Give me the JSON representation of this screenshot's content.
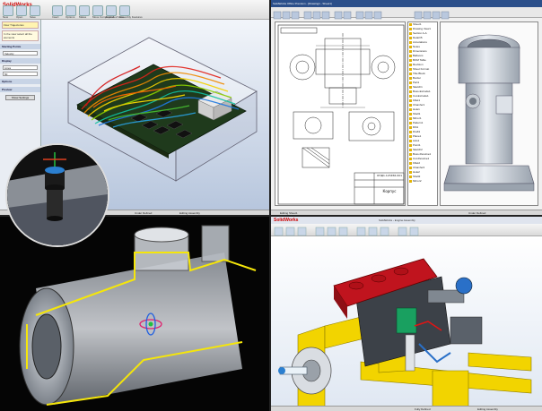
{
  "app": {
    "brand": "SolidWorks"
  },
  "panels": {
    "top_left": {
      "ribbon_labels": [
        "New",
        "Open",
        "Save",
        "Insert",
        "Options",
        "Mates",
        "Move Component",
        "Exploded View",
        "Assembly Features"
      ],
      "pm_header": "Flow Trajectories",
      "pm_message": "In the view select all the elements",
      "pm_sections": [
        "Starting Points",
        "Display",
        "Options",
        "Preview"
      ],
      "pm_fields": [
        "Velocity",
        "Lines",
        "50"
      ],
      "pm_button": "Show Settings",
      "status": [
        "Under Defined",
        "Editing Assembly"
      ]
    },
    "top_right": {
      "title": "SolidWorks Office Premium - [Drawing1 - Sheet1]",
      "title_block": "КПД1.123456.001",
      "title_block_name": "Корпус",
      "tree_items": [
        "Sheet1",
        "Drawing View1",
        "Section A-A",
        "Detail B",
        "Annotations",
        "Notes",
        "Dimensions",
        "Balloons",
        "BOM Table",
        "Revision",
        "Sheet Format",
        "Title Block",
        "Border",
        "Part1",
        "Sketch1",
        "Boss-Extrude1",
        "Cut-Extrude1",
        "Fillet1",
        "Chamfer1",
        "Hole1",
        "Shell1",
        "Mirror1",
        "Pattern1",
        "Rib1",
        "Draft1",
        "Plane1",
        "Axis1",
        "Point1",
        "Sketch2",
        "Boss-Revolve1",
        "Cut-Revolve1",
        "Fillet2",
        "Chamfer2",
        "Hole2",
        "Shell2",
        "Mirror2"
      ],
      "status": [
        "Editing Sheet1",
        "Under Defined"
      ]
    },
    "bottom_right": {
      "title": "SolidWorks - Engine Assembly",
      "status": [
        "Fully Defined",
        "Editing Assembly"
      ]
    }
  },
  "colors": {
    "accent": "#c00000",
    "ribbon": "#dcdcdc",
    "highlight_yellow": "#f5e60a",
    "engine_red": "#c0141e"
  },
  "icons": [
    "new-icon",
    "open-icon",
    "save-icon",
    "insert-icon",
    "options-icon",
    "mates-icon",
    "move-component-icon",
    "exploded-view-icon",
    "assembly-features-icon"
  ]
}
